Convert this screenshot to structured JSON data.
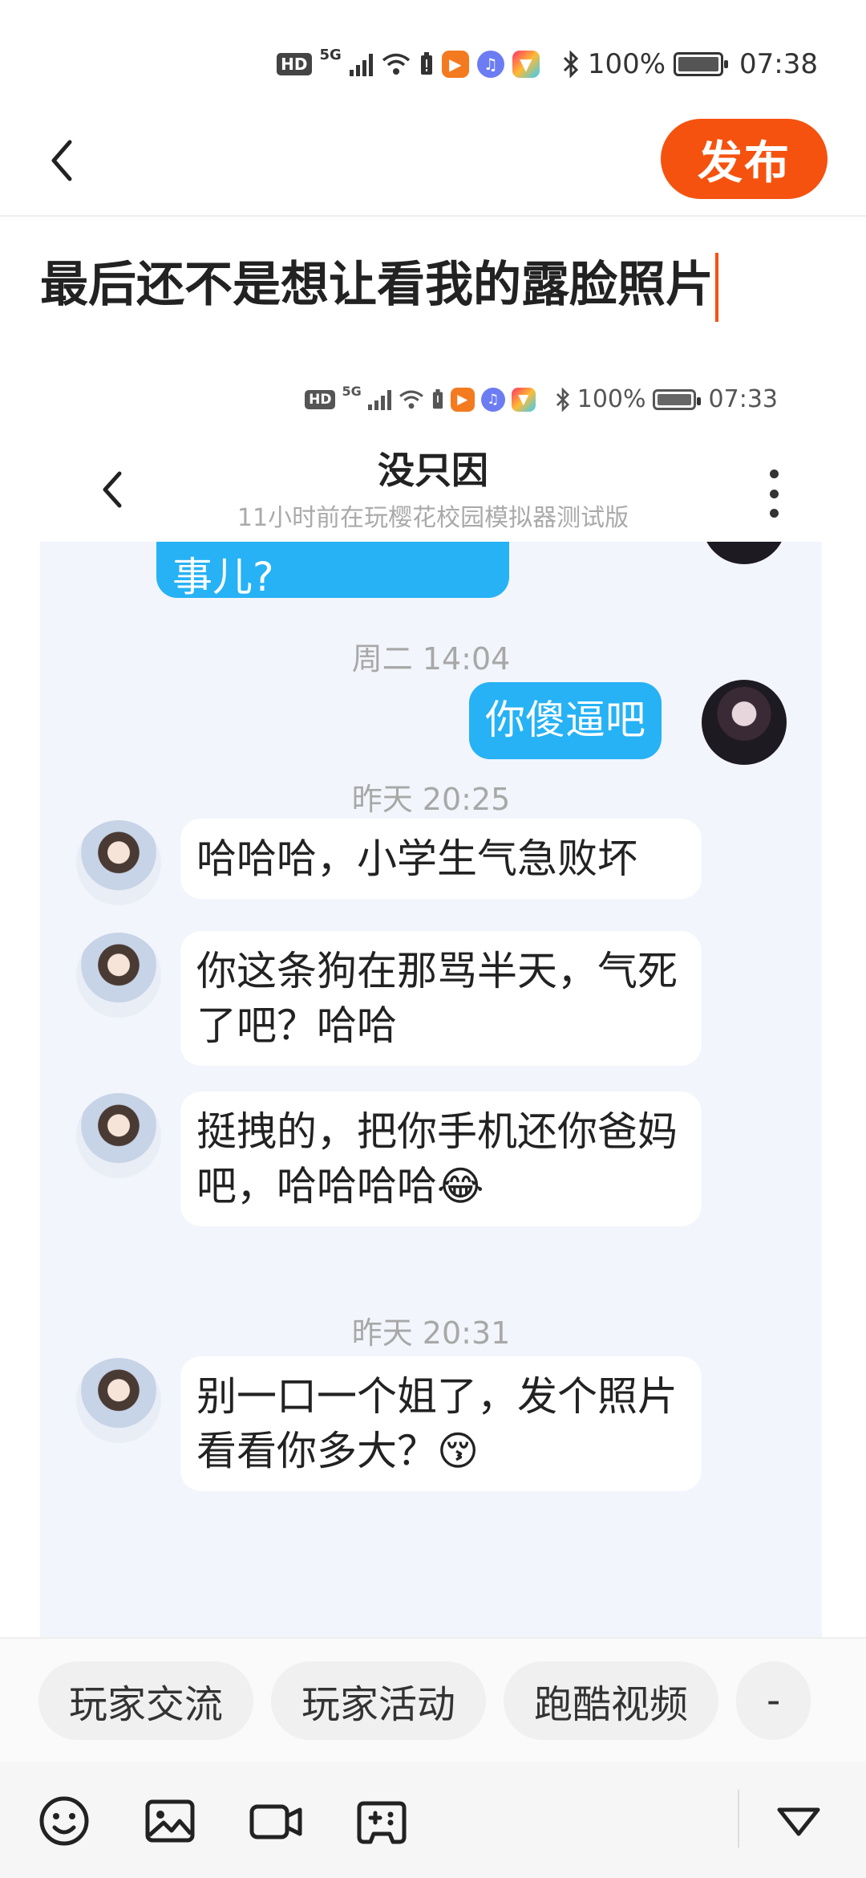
{
  "status_bar": {
    "hd": "HD",
    "network": "5G",
    "battery": "100%",
    "time": "07:38"
  },
  "header": {
    "back_icon": "chevron-left-icon",
    "publish_label": "发布"
  },
  "post": {
    "title_value": "最后还不是想让看我的露脸照片"
  },
  "embedded_screenshot": {
    "status_bar": {
      "hd": "HD",
      "network": "5G",
      "battery": "100%",
      "time": "07:33"
    },
    "chat": {
      "name": "没只因",
      "subtitle": "11小时前在玩樱花校园模拟器测试版",
      "messages": [
        {
          "side": "me",
          "text": "事儿?"
        },
        {
          "type": "timestamp",
          "text": "周二 14:04"
        },
        {
          "side": "me",
          "text": "你傻逼吧"
        },
        {
          "type": "timestamp",
          "text": "昨天 20:25"
        },
        {
          "side": "them",
          "text": "哈哈哈，小学生气急败坏"
        },
        {
          "side": "them",
          "text": "你这条狗在那骂半天，气死了吧？哈哈"
        },
        {
          "side": "them",
          "text": "挺拽的，把你手机还你爸妈吧，哈哈哈哈😂"
        },
        {
          "type": "timestamp",
          "text": "昨天 20:31"
        },
        {
          "side": "them",
          "text": "别一口一个姐了，发个照片看看你多大？😚"
        }
      ]
    }
  },
  "tags": [
    "玩家交流",
    "玩家活动",
    "跑酷视频",
    "-"
  ],
  "toolbar": {
    "icons": [
      "emoji-icon",
      "image-icon",
      "video-icon",
      "gamepad-icon",
      "collapse-icon"
    ]
  },
  "colors": {
    "accent": "#f5520f",
    "my_bubble": "#26b2f5",
    "chat_bg": "#f2f5fb"
  }
}
